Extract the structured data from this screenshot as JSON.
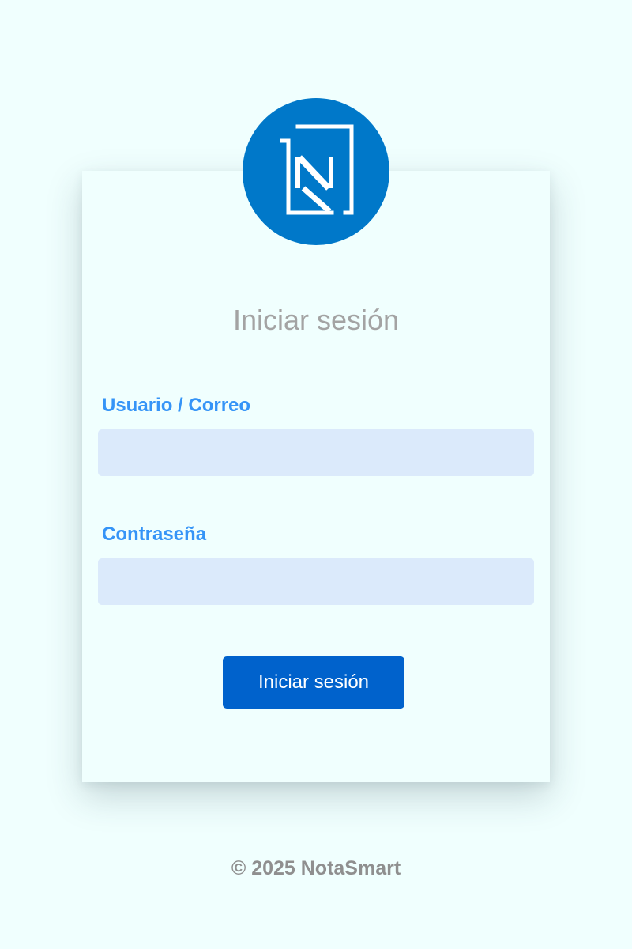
{
  "brand": {
    "logo_icon": "notasmart-n-logo-icon",
    "logo_color": "#0078c9"
  },
  "login": {
    "title": "Iniciar sesión",
    "username_label": "Usuario / Correo",
    "username_value": "",
    "username_placeholder": "",
    "password_label": "Contraseña",
    "password_value": "",
    "password_placeholder": "",
    "submit_label": "Iniciar sesión"
  },
  "footer": {
    "copyright": "© 2025 NotaSmart"
  },
  "colors": {
    "background": "#f0fffe",
    "label": "#3594f7",
    "input_background": "#dbeafb",
    "button": "#0062cc",
    "title": "#a3a3a3",
    "footer": "#8f8f8f"
  }
}
